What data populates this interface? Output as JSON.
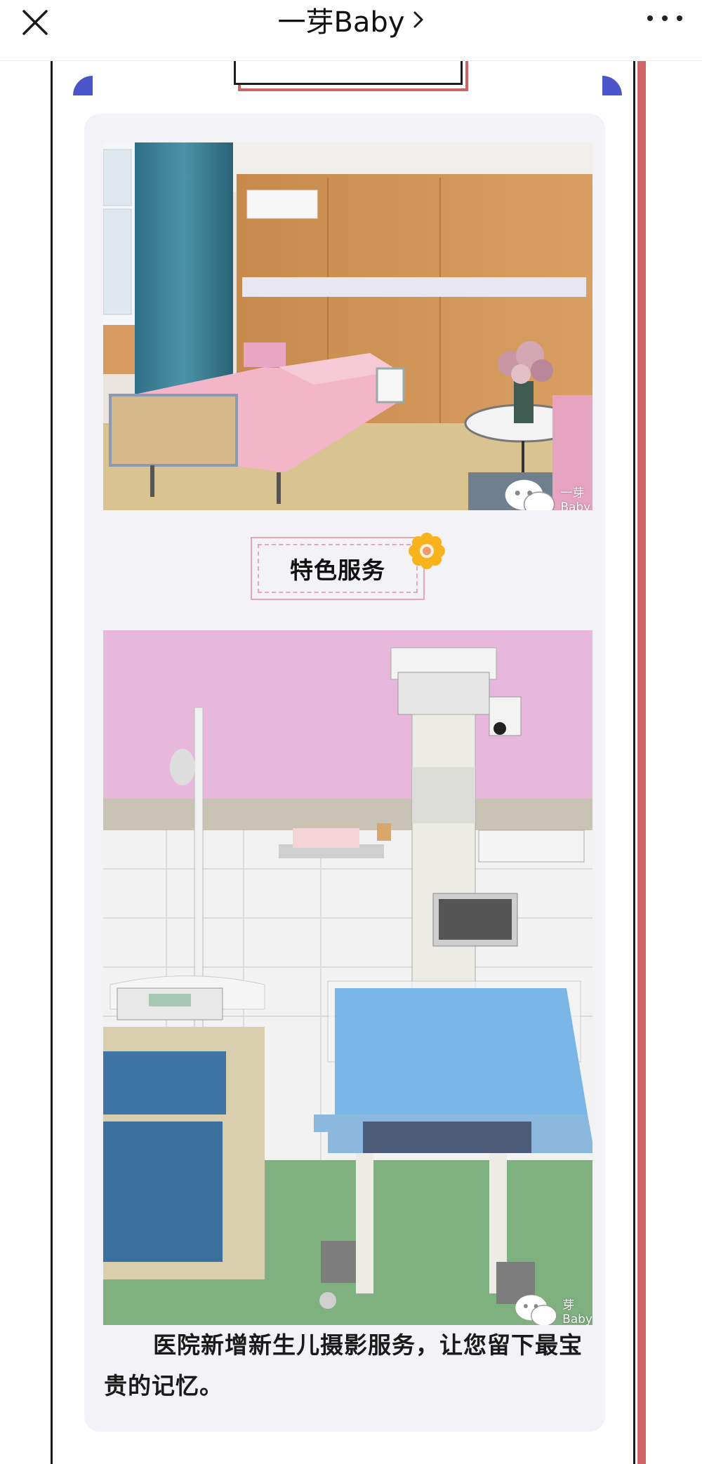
{
  "header": {
    "title": "一芽Baby",
    "icons": {
      "close": "close-icon",
      "chevron": "chevron-right-icon",
      "more": "more-icon"
    }
  },
  "section": {
    "title": "特色服务"
  },
  "watermark": {
    "text": "一芽Baby",
    "text2": "芽Baby"
  },
  "caption": "医院新增新生儿摄影服务，让您留下最宝贵的记忆。",
  "colors": {
    "accent_red": "#cf6467",
    "accent_blue": "#4b54c9",
    "pink_border": "#e7a8b5"
  }
}
